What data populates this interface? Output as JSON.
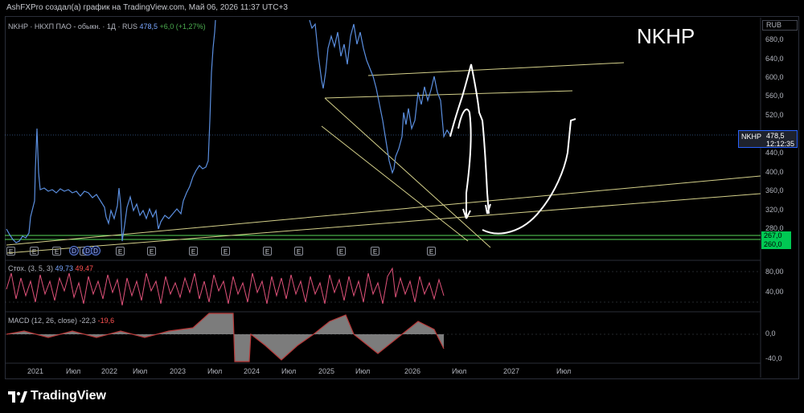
{
  "header": {
    "credit": "AshFXPro создал(а) график на TradingView.com, Май 06, 2026 11:37 UTC+3"
  },
  "symbol": {
    "line": "NKHP · НКХП ПАО - обыкн. · 1Д · RUS",
    "value": "478,5",
    "change": "+6,0 (+1,27%)",
    "big_ticker": "NKHP"
  },
  "price_axis": {
    "currency": "RUB",
    "labels": [
      "680,0",
      "640,0",
      "600,0",
      "560,0",
      "520,0",
      "440,0",
      "400,0",
      "360,0",
      "320,0",
      "280,0"
    ],
    "last_tag": {
      "name": "NKHP",
      "price": "478,5",
      "countdown": "12:12:35"
    },
    "level_tags": [
      "267,0",
      "260,0"
    ]
  },
  "events": {
    "e_label": "E",
    "d_label": "D"
  },
  "stochastic": {
    "label": "Стох. (3, 5, 3)",
    "k": "49,73",
    "d": "49,47",
    "axis": [
      "80,00",
      "40,00"
    ]
  },
  "macd": {
    "label": "MACD (12, 26, close)",
    "macd": "-22,3",
    "signal": "-19,6",
    "axis": [
      "0,0",
      "-40,0"
    ]
  },
  "time_axis": [
    "2021",
    "Июл",
    "2022",
    "Июл",
    "2023",
    "Июл",
    "2024",
    "Июл",
    "2025",
    "Июл",
    "2026",
    "Июл",
    "2027",
    "Июл"
  ],
  "brand": "TradingView",
  "colors": {
    "price_line": "#5b8fe0",
    "trend_lines": "#d4d08a",
    "level_lines": "#57d957",
    "stoch": "#e0527a",
    "macd": "#b83a3a",
    "drawing": "#ffffff"
  }
}
